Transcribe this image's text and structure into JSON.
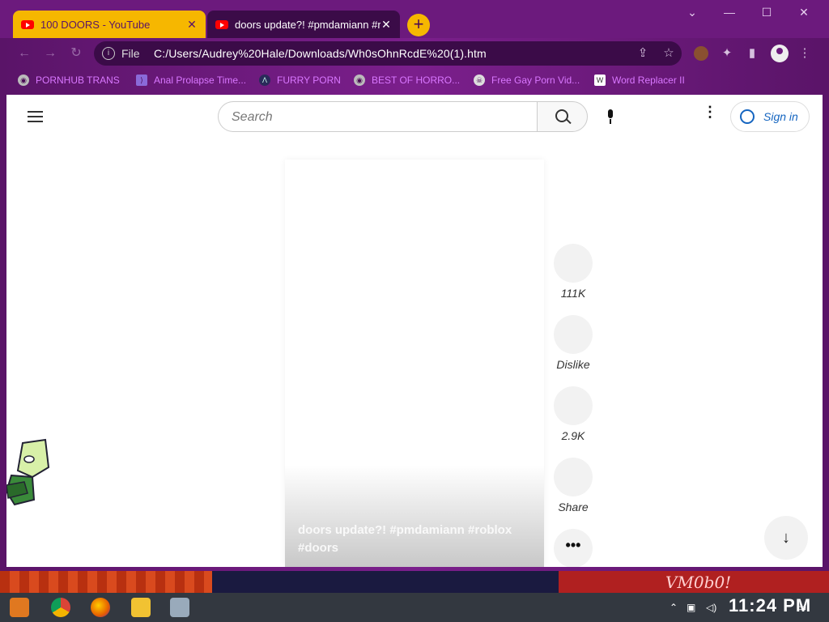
{
  "browser": {
    "tabs": [
      {
        "title": "100 DOORS - YouTube",
        "close": "✕"
      },
      {
        "title": "doors update?! #pmdamiann #r",
        "close": "✕"
      }
    ],
    "new_tab": "+",
    "window_controls": {
      "minimize": "—",
      "maximize": "☐",
      "close": "✕",
      "dropdown": "⌄"
    },
    "nav": {
      "back": "←",
      "forward": "→",
      "reload": "↻"
    },
    "address": {
      "scheme_label": "File",
      "url": "C:/Users/Audrey%20Hale/Downloads/Wh0sOhnRcdE%20(1).htm"
    },
    "bookmarks": [
      {
        "label": "PORNHUB TRANS",
        "icon": "globe-icon"
      },
      {
        "label": "Anal Prolapse Time...",
        "icon": "bookmark-icon"
      },
      {
        "label": "FURRY PORN",
        "icon": "a-logo-icon"
      },
      {
        "label": "BEST OF HORRO...",
        "icon": "globe-icon"
      },
      {
        "label": "Free Gay Porn Vid...",
        "icon": "skull-icon"
      },
      {
        "label": "Word Replacer II",
        "icon": "wr-icon"
      }
    ]
  },
  "page": {
    "search": {
      "placeholder": "Search"
    },
    "sign_in": "Sign in",
    "video": {
      "title": "doors update?! #pmdamiann #roblox #doors"
    },
    "actions": [
      {
        "label": "111K",
        "name": "like"
      },
      {
        "label": "Dislike",
        "name": "dislike"
      },
      {
        "label": "2.9K",
        "name": "comments"
      },
      {
        "label": "Share",
        "name": "share"
      }
    ],
    "more": "•••",
    "scroll_down": "↓"
  },
  "taskbar": {
    "clock": "11:24 PM",
    "watermark": "VM0b0!"
  }
}
